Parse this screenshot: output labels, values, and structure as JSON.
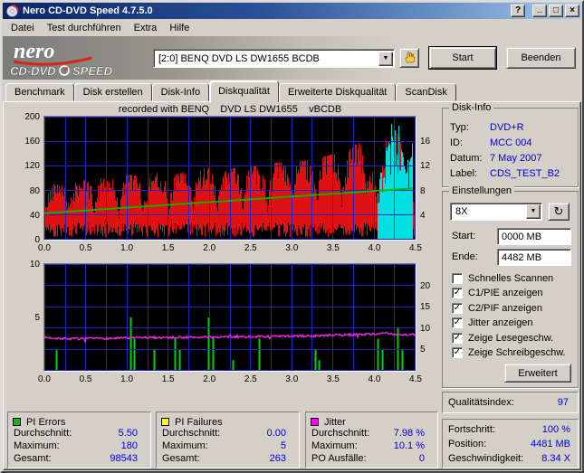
{
  "window": {
    "title": "Nero CD-DVD Speed 4.7.5.0",
    "controls": {
      "help": "?",
      "minimize": "_",
      "maximize": "□",
      "close": "×"
    }
  },
  "icons": {
    "dropdown_arrow": "▼",
    "refresh": "↻",
    "check": "✓"
  },
  "menu": {
    "items": [
      {
        "label": "Datei"
      },
      {
        "label": "Test durchführen"
      },
      {
        "label": "Extra"
      },
      {
        "label": "Hilfe"
      }
    ]
  },
  "banner": {
    "logo_script": "nero",
    "logo_cd": "CD-DVD",
    "logo_speed": "SPEED",
    "drive_select": {
      "value": "[2:0]  BENQ DVD LS DW1655 BCDB"
    },
    "start_button": "Start",
    "quit_button": "Beenden"
  },
  "tabs": {
    "selected_index": 3,
    "items": [
      "Benchmark",
      "Disk erstellen",
      "Disk-Info",
      "Diskqualität",
      "Erweiterte Diskqualität",
      "ScanDisk"
    ]
  },
  "chart_header": "recorded with BENQ    DVD LS DW1655    vBCDB",
  "disk_info": {
    "title": "Disk-Info",
    "rows": [
      [
        "Typ:",
        "DVD+R"
      ],
      [
        "ID:",
        "MCC 004"
      ],
      [
        "Datum:",
        "7 May 2007"
      ],
      [
        "Label:",
        "CDS_TEST_B2"
      ]
    ]
  },
  "settings": {
    "title": "Einstellungen",
    "speed": "8X",
    "start_label": "Start:",
    "start_value": "0000 MB",
    "end_label": "Ende:",
    "end_value": "4482 MB",
    "checkboxes": [
      {
        "label": "Schnelles Scannen",
        "checked": false
      },
      {
        "label": "C1/PIE anzeigen",
        "checked": true
      },
      {
        "label": "C2/PIF anzeigen",
        "checked": true
      },
      {
        "label": "Jitter anzeigen",
        "checked": true
      },
      {
        "label": "Zeige Lesegeschw.",
        "checked": true
      },
      {
        "label": "Zeige Schreibgeschw.",
        "checked": true
      }
    ],
    "advanced_button": "Erweitert"
  },
  "quality": {
    "label": "Qualitätsindex:",
    "value": "97"
  },
  "progress": {
    "rows": [
      [
        "Fortschritt:",
        "100 %"
      ],
      [
        "Position:",
        "4481 MB"
      ],
      [
        "Geschwindigkeit:",
        "8.34 X"
      ]
    ]
  },
  "stats": [
    {
      "name": "PI Errors",
      "chip": "#00c000",
      "rows": [
        [
          "Durchschnitt:",
          "5.50"
        ],
        [
          "Maximum:",
          "180"
        ],
        [
          "Gesamt:",
          "98543"
        ]
      ]
    },
    {
      "name": "PI Failures",
      "chip": "#ffff00",
      "rows": [
        [
          "Durchschnitt:",
          "0.00"
        ],
        [
          "Maximum:",
          "5"
        ],
        [
          "Gesamt:",
          "263"
        ]
      ]
    },
    {
      "name": "Jitter",
      "chip": "#ff00ff",
      "rows": [
        [
          "Durchschnitt:",
          "7.98 %"
        ],
        [
          "Maximum:",
          "10.1 %"
        ],
        [
          "PO Ausfälle:",
          "0"
        ]
      ]
    }
  ],
  "chart_data": [
    {
      "type": "area",
      "name": "pi-errors-and-speed",
      "x_range": [
        0,
        4.5
      ],
      "grid_step_x": 0.25,
      "x_ticks": [
        "0.0",
        "0.5",
        "1.0",
        "1.5",
        "2.0",
        "2.5",
        "3.0",
        "3.5",
        "4.0",
        "4.5"
      ],
      "left_axis": {
        "max": 200,
        "ticks": [
          [
            "200",
            0
          ],
          [
            "160",
            0.2
          ],
          [
            "120",
            0.4
          ],
          [
            "80",
            0.6
          ],
          [
            "40",
            0.8
          ],
          [
            "0",
            1
          ]
        ]
      },
      "right_axis": {
        "max": 20,
        "ticks": [
          [
            "16",
            0.2
          ],
          [
            "12",
            0.4
          ],
          [
            "8",
            0.6
          ],
          [
            "4",
            0.8
          ]
        ]
      },
      "series": {
        "pie_envelope": [
          [
            0,
            78
          ],
          [
            0.2,
            92
          ],
          [
            0.4,
            88
          ],
          [
            0.6,
            96
          ],
          [
            0.8,
            92
          ],
          [
            1,
            100
          ],
          [
            1.2,
            96
          ],
          [
            1.4,
            104
          ],
          [
            1.6,
            100
          ],
          [
            1.8,
            108
          ],
          [
            2,
            110
          ],
          [
            2.2,
            106
          ],
          [
            2.4,
            114
          ],
          [
            2.6,
            112
          ],
          [
            2.8,
            118
          ],
          [
            3,
            120
          ],
          [
            3.2,
            122
          ],
          [
            3.4,
            128
          ],
          [
            3.6,
            135
          ],
          [
            3.8,
            148
          ],
          [
            3.92,
            150
          ],
          [
            3.98,
            100
          ],
          [
            4.04,
            60
          ],
          [
            4.1,
            120
          ],
          [
            4.16,
            190
          ],
          [
            4.24,
            193
          ],
          [
            4.3,
            160
          ],
          [
            4.36,
            110
          ],
          [
            4.42,
            80
          ],
          [
            4.46,
            70
          ]
        ],
        "tooth_period": 0.3,
        "write_speed_line": [
          [
            0,
            4.3
          ],
          [
            4.46,
            8.34
          ]
        ],
        "end_burst": {
          "range": [
            4.03,
            4.46
          ],
          "envelope": [
            [
              4.03,
              70
            ],
            [
              4.08,
              120
            ],
            [
              4.14,
              185
            ],
            [
              4.2,
              200
            ],
            [
              4.28,
              195
            ],
            [
              4.34,
              175
            ],
            [
              4.4,
              150
            ],
            [
              4.46,
              168
            ]
          ]
        }
      }
    },
    {
      "type": "line",
      "name": "jitter-and-pi-failures",
      "x_range": [
        0,
        4.5
      ],
      "grid_step_x": 0.25,
      "x_ticks": [
        "0.0",
        "0.5",
        "1.0",
        "1.5",
        "2.0",
        "2.5",
        "3.0",
        "3.5",
        "4.0",
        "4.5"
      ],
      "left_axis": {
        "max": 10,
        "ticks": [
          [
            "10",
            0
          ],
          [
            "5",
            0.5
          ]
        ]
      },
      "right_axis": {
        "max": 25,
        "ticks": [
          [
            "20",
            0.2
          ],
          [
            "15",
            0.4
          ],
          [
            "10",
            0.6
          ],
          [
            "5",
            0.8
          ]
        ]
      },
      "series": {
        "jitter_envelope": [
          [
            0,
            7.8
          ],
          [
            0.3,
            7.5
          ],
          [
            0.8,
            7.6
          ],
          [
            1.3,
            7.8
          ],
          [
            1.8,
            7.85
          ],
          [
            2.3,
            7.95
          ],
          [
            2.8,
            8.05
          ],
          [
            3.3,
            8.2
          ],
          [
            3.7,
            8.45
          ],
          [
            3.95,
            8.6
          ],
          [
            4.15,
            8.75
          ],
          [
            4.3,
            8.45
          ],
          [
            4.46,
            8.55
          ]
        ],
        "pif_spikes": [
          [
            0.14,
            2
          ],
          [
            1.04,
            5
          ],
          [
            1.09,
            3
          ],
          [
            1.33,
            2
          ],
          [
            1.58,
            3
          ],
          [
            1.64,
            2
          ],
          [
            1.99,
            5
          ],
          [
            2.04,
            3
          ],
          [
            2.28,
            1
          ],
          [
            2.6,
            3
          ],
          [
            3.28,
            2
          ],
          [
            3.33,
            1
          ],
          [
            4.04,
            3
          ],
          [
            4.09,
            2
          ],
          [
            4.28,
            4
          ],
          [
            4.33,
            2
          ]
        ]
      }
    }
  ]
}
